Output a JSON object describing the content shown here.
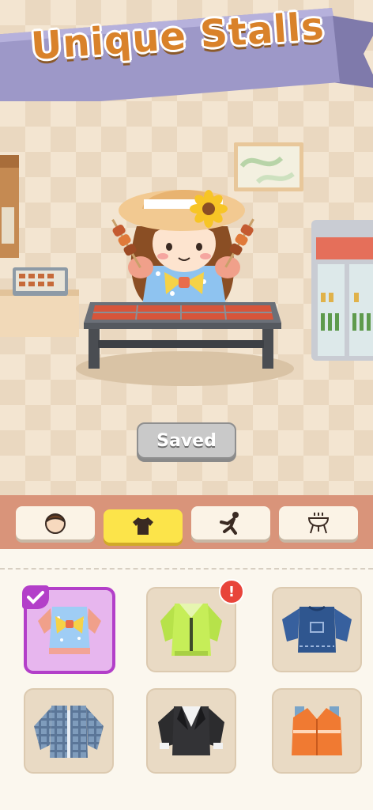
{
  "banner": {
    "title": "Unique Stalls"
  },
  "stall": {
    "saved_label": "Saved"
  },
  "tabs": [
    {
      "icon": "face-icon",
      "active": false
    },
    {
      "icon": "shirt-icon",
      "active": true
    },
    {
      "icon": "pose-icon",
      "active": false
    },
    {
      "icon": "grill-icon",
      "active": false
    }
  ],
  "wardrobe": {
    "items": [
      {
        "icon": "blue-bow-blouse-icon",
        "selected": true,
        "new": false
      },
      {
        "icon": "green-jacket-icon",
        "selected": false,
        "new": true,
        "alert": "!"
      },
      {
        "icon": "navy-sweater-icon",
        "selected": false,
        "new": false
      },
      {
        "icon": "plaid-shirt-icon",
        "selected": false,
        "new": false
      },
      {
        "icon": "black-suit-icon",
        "selected": false,
        "new": false
      },
      {
        "icon": "orange-vest-icon",
        "selected": false,
        "new": false
      }
    ]
  },
  "colors": {
    "accent": "#b33fc9",
    "tab_active": "#fce44a",
    "tab_bar": "#d9947a",
    "banner": "#9d98c8",
    "title": "#d9822a"
  }
}
